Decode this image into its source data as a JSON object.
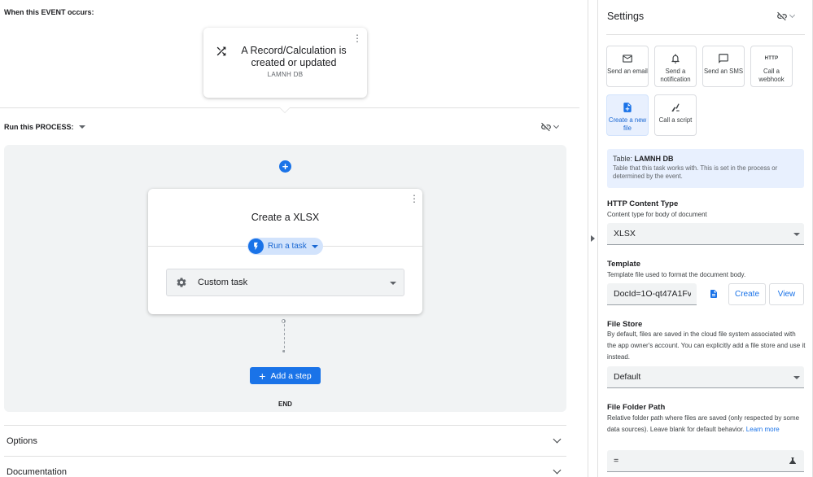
{
  "event": {
    "label": "When this EVENT occurs:",
    "title": "A Record/Calculation is created or updated",
    "subtitle": "LAMNH DB"
  },
  "process": {
    "label": "Run this PROCESS:",
    "task_title": "Create a XLSX",
    "run_chip_label": "Run a task",
    "task_type": "Custom task",
    "add_step_label": "Add a step",
    "end_label": "END"
  },
  "sections": {
    "options": "Options",
    "documentation": "Documentation"
  },
  "settings": {
    "title": "Settings",
    "tiles": [
      {
        "label": "Send an email",
        "icon": "email-icon"
      },
      {
        "label": "Send a notification",
        "icon": "bell-icon"
      },
      {
        "label": "Send an SMS",
        "icon": "sms-icon"
      },
      {
        "label": "Call a webhook",
        "icon": "http-icon",
        "icon_text": "HTTP"
      },
      {
        "label": "Create a new file",
        "icon": "new-file-icon",
        "active": true
      },
      {
        "label": "Call a script",
        "icon": "script-icon"
      }
    ],
    "table_info": {
      "prefix": "Table:",
      "name": "LAMNH DB",
      "description": "Table that this task works with. This is set in the process or determined by the event."
    },
    "http_content_type": {
      "label": "HTTP Content Type",
      "description": "Content type for body of document",
      "value": "XLSX"
    },
    "template": {
      "label": "Template",
      "description": "Template file used to format the document body.",
      "value": "DocId=1O-qt47A1Fv",
      "create_label": "Create",
      "view_label": "View"
    },
    "file_store": {
      "label": "File Store",
      "description": "By default, files are saved in the cloud file system associated with the app owner's account. You can explicitly add a file store and use it instead.",
      "value": "Default"
    },
    "file_folder_path": {
      "label": "File Folder Path",
      "description": "Relative folder path where files are saved (only respected by some data sources). Leave blank for default behavior.",
      "learn_more": "Learn more",
      "value": "="
    }
  },
  "colors": {
    "accent": "#1a73e8",
    "chip_bg": "#d2e3fc",
    "panel_bg": "#f1f3f4",
    "info_bg": "#e8f0fe"
  }
}
